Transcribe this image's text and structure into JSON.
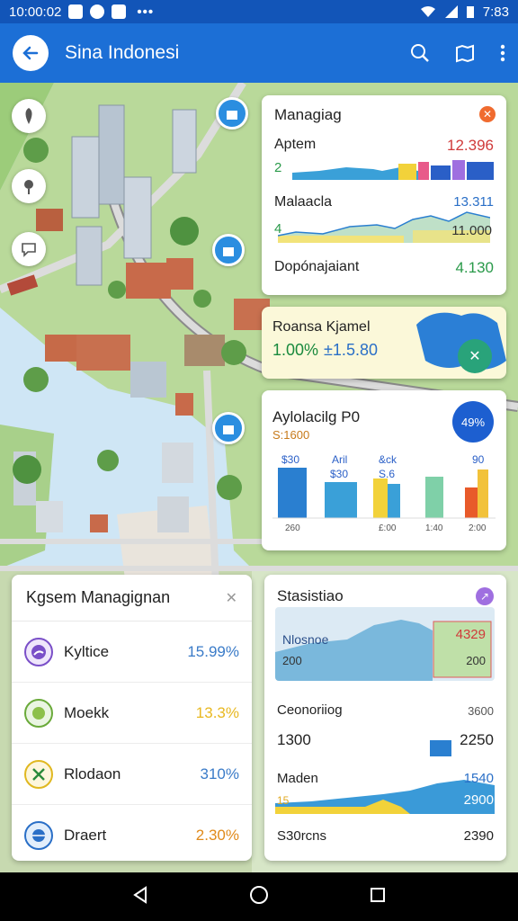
{
  "status_bar": {
    "left_text": "10:00:02",
    "time": "7:83"
  },
  "app_bar": {
    "title": "Sina Indonesi"
  },
  "managing": {
    "title": "Managiag",
    "rows": [
      {
        "label": "Aptem",
        "value": "12.396",
        "sub": "2"
      },
      {
        "label": "Malaacla",
        "value": "13.311",
        "sub": "4",
        "value2": "11.000"
      },
      {
        "label": "Dopónajaiant",
        "value": "4.130"
      }
    ]
  },
  "bank": {
    "title": "Roansa Kjamel",
    "value_green": "1.00%",
    "value_blue": "±1.5.80"
  },
  "analysis": {
    "title": "Aylolacilg P0",
    "sub": "S:1600",
    "badge": "49%",
    "bar_labels_top": [
      "$30",
      "Aril",
      "&ck",
      "90"
    ],
    "bar_labels_mid": [
      "$30",
      "S.6"
    ],
    "axis_labels": [
      "260",
      "£:00",
      "1:40",
      "2:00"
    ]
  },
  "system": {
    "title": "Kgsem Managignan",
    "rows": [
      {
        "name": "Kyltice",
        "value": "15.99%",
        "color": "#3a7bc8"
      },
      {
        "name": "Moekk",
        "value": "13.3%",
        "color": "#e8b820"
      },
      {
        "name": "Rlodaon",
        "value": "310%",
        "color": "#3a7bc8"
      },
      {
        "name": "Draert",
        "value": "2.30%",
        "color": "#e08a1a"
      }
    ]
  },
  "statistics": {
    "title": "Stasistiao",
    "chart_label": "Nlosnoe",
    "chart_label2": "200",
    "chart_value": "4329",
    "chart_value2": "200",
    "line1_label": "Ceonoriiog",
    "line1_value": "3600",
    "line2_label": "1300",
    "line2_value": "2250",
    "line3_label": "Maden",
    "line3_value": "1540",
    "line3_sub": "15",
    "line3_value2": "2900",
    "line4_label": "S30rcns",
    "line4_value": "2390"
  }
}
